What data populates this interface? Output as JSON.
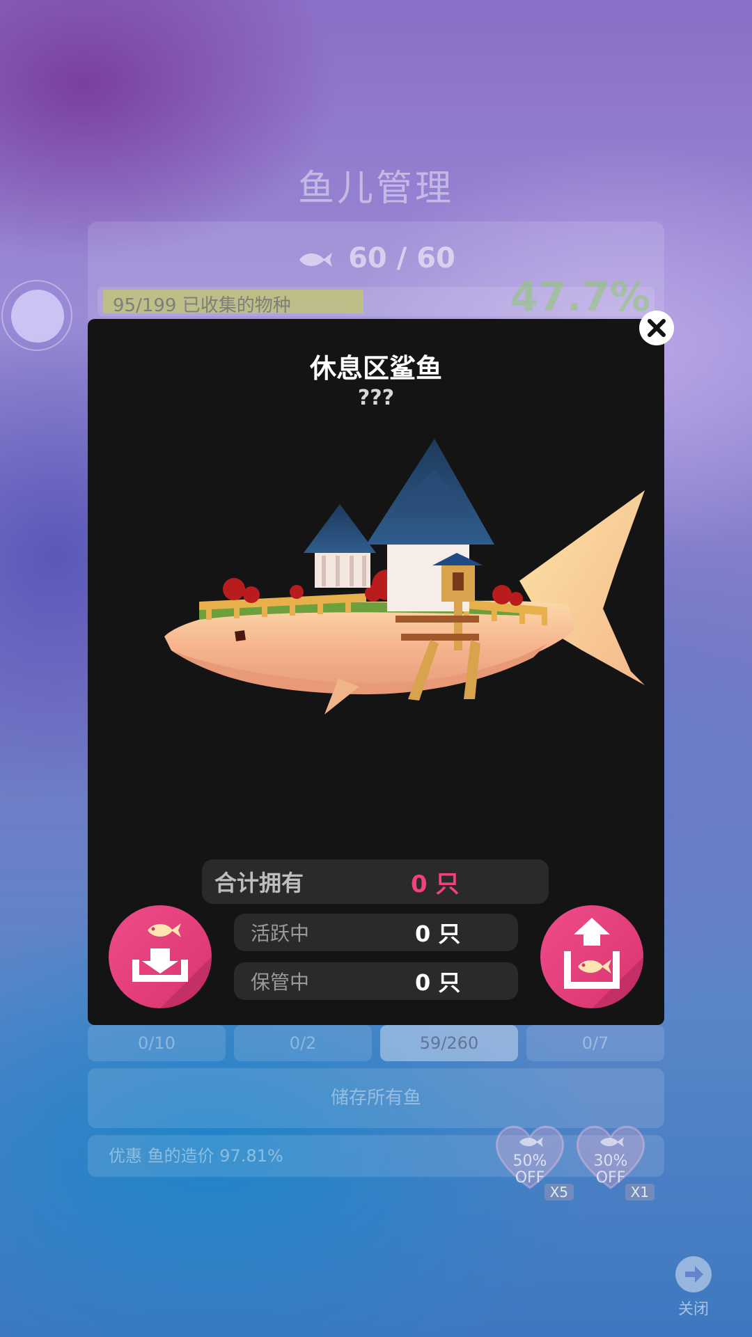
{
  "background": {
    "title": "鱼儿管理",
    "fish_count": "60 / 60",
    "collection_progress_text": "95/199 已收集的物种",
    "collection_fraction": 0.477,
    "collection_percent": "47.7%",
    "tabs": [
      {
        "label": "0/10"
      },
      {
        "label": "0/2"
      },
      {
        "label": "59/260",
        "active": true
      },
      {
        "label": "0/7"
      }
    ],
    "store_all_button": "储存所有鱼",
    "discount_text": "优惠 鱼的造价 97.81%",
    "coupons": [
      {
        "percent": "50%",
        "off": "OFF",
        "multiplier": "X5"
      },
      {
        "percent": "30%",
        "off": "OFF",
        "multiplier": "X1"
      }
    ],
    "close_label": "关闭"
  },
  "modal": {
    "title": "休息区鲨鱼",
    "subtitle": "???",
    "stats": {
      "total_label": "合计拥有",
      "total_value": "0 只",
      "active_label": "活跃中",
      "active_value": "0 只",
      "stored_label": "保管中",
      "stored_value": "0 只"
    },
    "colors": {
      "accent_pink": "#e43f7c",
      "total_value": "#f0427d",
      "modal_bg": "#141414"
    }
  },
  "icons": {
    "close": "close-icon",
    "store": "fish-store-icon",
    "release": "fish-release-icon",
    "fish": "fish-icon",
    "exit": "arrow-right-icon"
  }
}
